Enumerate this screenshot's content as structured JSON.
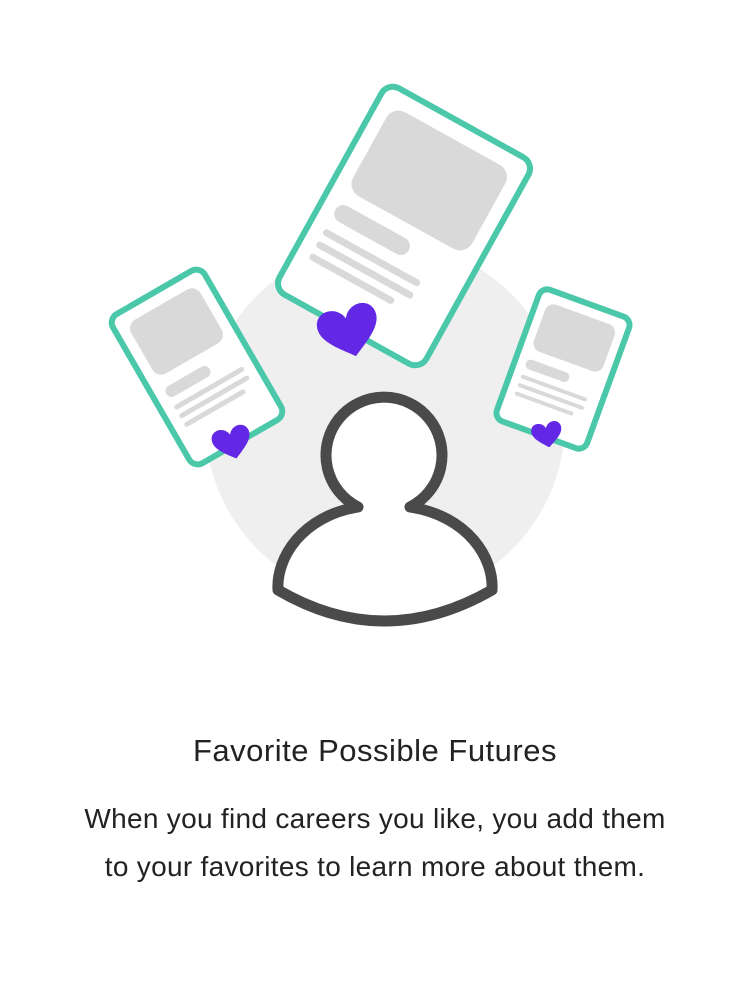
{
  "title": "Favorite Possible Futures",
  "description": "When you find careers you like, you add them to your favorites to learn more about them.",
  "colors": {
    "card_border": "#4BC8AA",
    "heart": "#6328E6",
    "placeholder": "#D9D9D9",
    "circle": "#EFEFEF",
    "person": "#4A4A4A"
  },
  "icons": [
    "career-card-icon",
    "heart-icon",
    "person-icon"
  ]
}
